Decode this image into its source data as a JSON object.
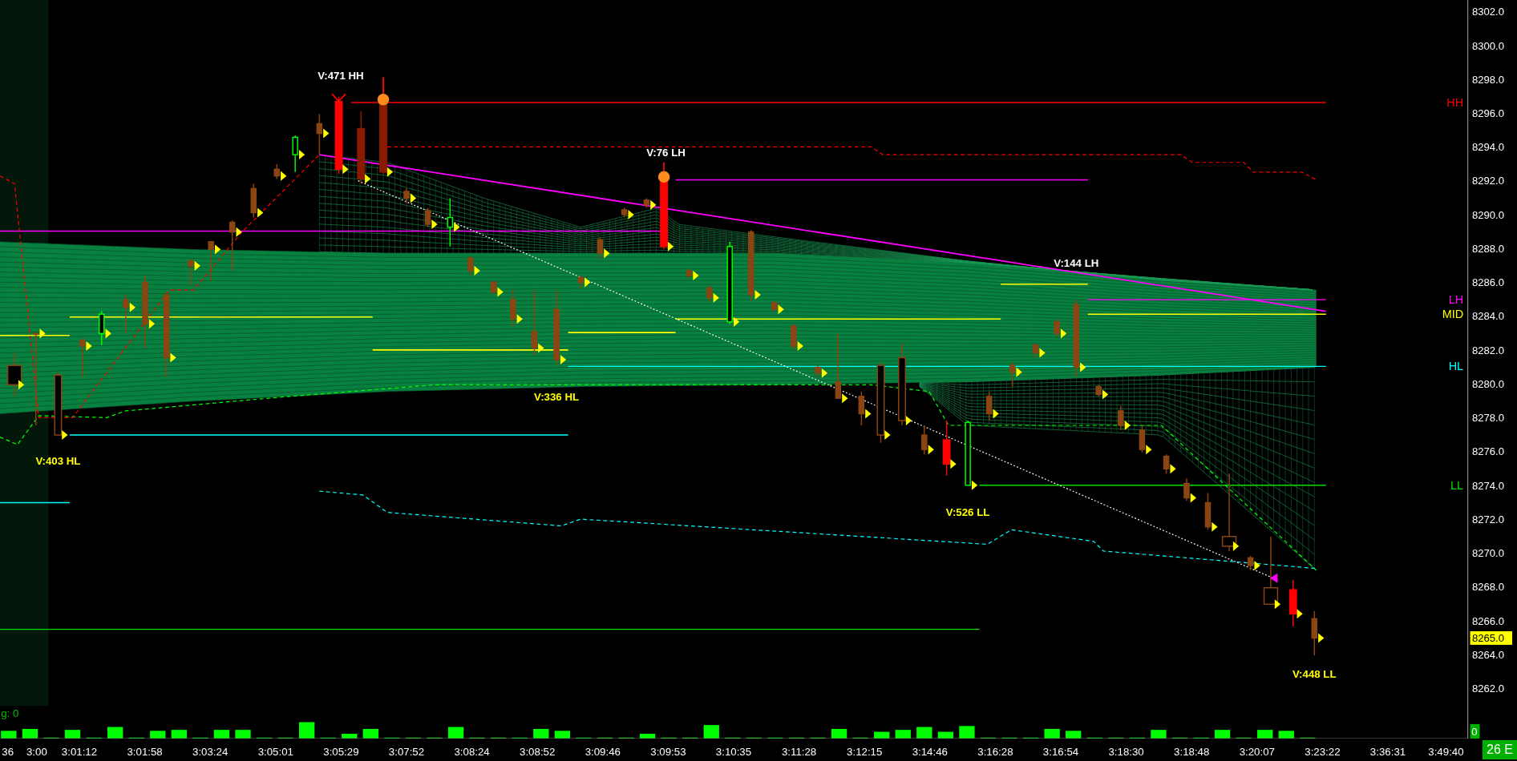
{
  "price_axis": {
    "ticks": [
      "8302.0",
      "8300.0",
      "8298.0",
      "8296.0",
      "8294.0",
      "8292.0",
      "8290.0",
      "8288.0",
      "8286.0",
      "8284.0",
      "8282.0",
      "8280.0",
      "8278.0",
      "8276.0",
      "8274.0",
      "8272.0",
      "8270.0",
      "8268.0",
      "8266.0",
      "8264.0",
      "8262.0"
    ],
    "current_price": "8265.0",
    "volume_zero": "0"
  },
  "level_labels": [
    {
      "text": "HH",
      "color": "#ff0000"
    },
    {
      "text": "LH",
      "color": "#ff00ff"
    },
    {
      "text": "MID",
      "color": "#ffff00"
    },
    {
      "text": "HL",
      "color": "#00ffff"
    },
    {
      "text": "LL",
      "color": "#00e000"
    }
  ],
  "annotations": [
    {
      "text": "V:471 HH",
      "color": "#ffffff"
    },
    {
      "text": "V:76 LH",
      "color": "#ffffff"
    },
    {
      "text": "V:144 LH",
      "color": "#ffffff"
    },
    {
      "text": "V:336 HL",
      "color": "#ffff00"
    },
    {
      "text": "V:403 HL",
      "color": "#ffff00"
    },
    {
      "text": "V:526 LL",
      "color": "#ffff00"
    },
    {
      "text": "V:448 LL",
      "color": "#ffff00"
    }
  ],
  "volume_label": "g: 0",
  "time_axis": {
    "labels": [
      "36",
      "3:00",
      "3:01:12",
      "3:01:58",
      "3:03:24",
      "3:05:01",
      "3:05:29",
      "3:07:52",
      "3:08:24",
      "3:08:52",
      "3:09:46",
      "3:09:53",
      "3:10:35",
      "3:11:28",
      "3:12:15",
      "3:14:46",
      "3:16:28",
      "3:16:54",
      "3:18:30",
      "3:18:48",
      "3:20:07",
      "3:23:22",
      "3:36:31",
      "3:49:40"
    ]
  },
  "status_badge": "26 E"
}
